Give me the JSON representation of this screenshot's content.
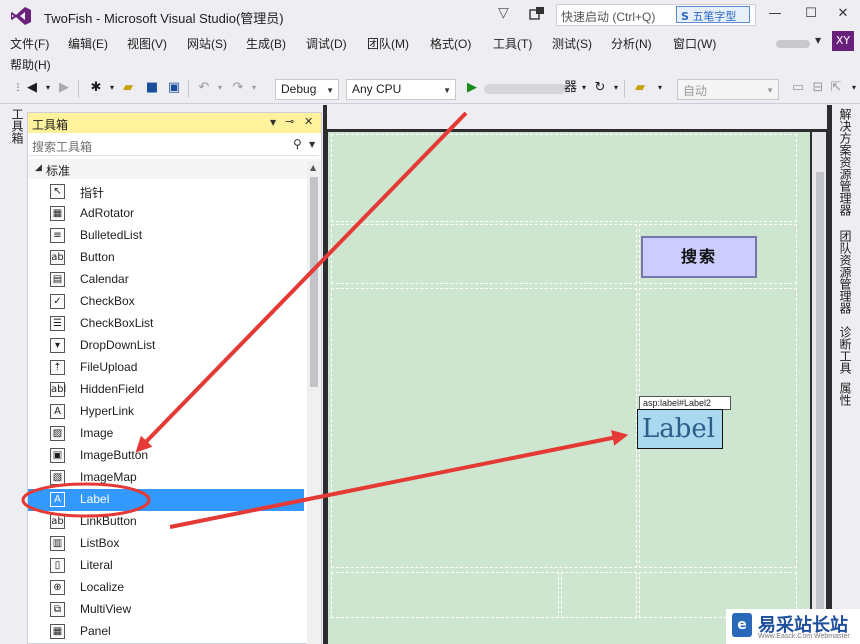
{
  "window": {
    "title": "TwoFish - Microsoft Visual Studio(管理员)",
    "quick_launch_placeholder": "快速启动 (Ctrl+Q)",
    "ime_badge": "五笔字型",
    "avatar_initials": "XY"
  },
  "menu": {
    "items": [
      "文件(F)",
      "编辑(E)",
      "视图(V)",
      "网站(S)",
      "生成(B)",
      "调试(D)",
      "团队(M)",
      "格式(O)",
      "工具(T)",
      "测试(S)",
      "分析(N)",
      "窗口(W)"
    ],
    "help": "帮助(H)"
  },
  "toolbar": {
    "config": "Debug",
    "platform": "Any CPU",
    "start_suffix": "器",
    "auto_combo": "自动"
  },
  "left_strip": {
    "tab": "工具箱"
  },
  "toolbox": {
    "title": "工具箱",
    "search_placeholder": "搜索工具箱",
    "group": "标准",
    "items": [
      {
        "label": "指针",
        "icon": "pointer-icon",
        "glyph": "↖"
      },
      {
        "label": "AdRotator",
        "icon": "adrotator-icon",
        "glyph": "▦"
      },
      {
        "label": "BulletedList",
        "icon": "bulletedlist-icon",
        "glyph": "≡"
      },
      {
        "label": "Button",
        "icon": "button-icon",
        "glyph": "ab"
      },
      {
        "label": "Calendar",
        "icon": "calendar-icon",
        "glyph": "▤"
      },
      {
        "label": "CheckBox",
        "icon": "checkbox-icon",
        "glyph": "✓"
      },
      {
        "label": "CheckBoxList",
        "icon": "checkboxlist-icon",
        "glyph": "☰"
      },
      {
        "label": "DropDownList",
        "icon": "dropdownlist-icon",
        "glyph": "▾"
      },
      {
        "label": "FileUpload",
        "icon": "fileupload-icon",
        "glyph": "⇡"
      },
      {
        "label": "HiddenField",
        "icon": "hiddenfield-icon",
        "glyph": "abl"
      },
      {
        "label": "HyperLink",
        "icon": "hyperlink-icon",
        "glyph": "A"
      },
      {
        "label": "Image",
        "icon": "image-icon",
        "glyph": "▨"
      },
      {
        "label": "ImageButton",
        "icon": "imagebutton-icon",
        "glyph": "▣"
      },
      {
        "label": "ImageMap",
        "icon": "imagemap-icon",
        "glyph": "▧"
      },
      {
        "label": "Label",
        "icon": "label-icon",
        "glyph": "A",
        "selected": true
      },
      {
        "label": "LinkButton",
        "icon": "linkbutton-icon",
        "glyph": "ab"
      },
      {
        "label": "ListBox",
        "icon": "listbox-icon",
        "glyph": "▥"
      },
      {
        "label": "Literal",
        "icon": "literal-icon",
        "glyph": "▯"
      },
      {
        "label": "Localize",
        "icon": "localize-icon",
        "glyph": "⊕"
      },
      {
        "label": "MultiView",
        "icon": "multiview-icon",
        "glyph": "⧉"
      },
      {
        "label": "Panel",
        "icon": "panel-icon",
        "glyph": "▦"
      }
    ]
  },
  "designer": {
    "search_button": "搜索",
    "label_tag": "asp:label#Label2",
    "label_text": "Label"
  },
  "right_strip": {
    "tabs": [
      "解决方案资源管理器",
      "团队资源管理器",
      "诊断工具",
      "属性"
    ]
  },
  "watermark": {
    "text": "易采站长站",
    "url": "Www.Easck.Com Webmaster",
    "logo_glyph": "e"
  },
  "colors": {
    "toolbox_header": "#fff29d",
    "selection": "#3399ff",
    "designer_bg": "#cee6d0",
    "annotation_red": "#e53935",
    "vs_purple": "#68217a"
  }
}
